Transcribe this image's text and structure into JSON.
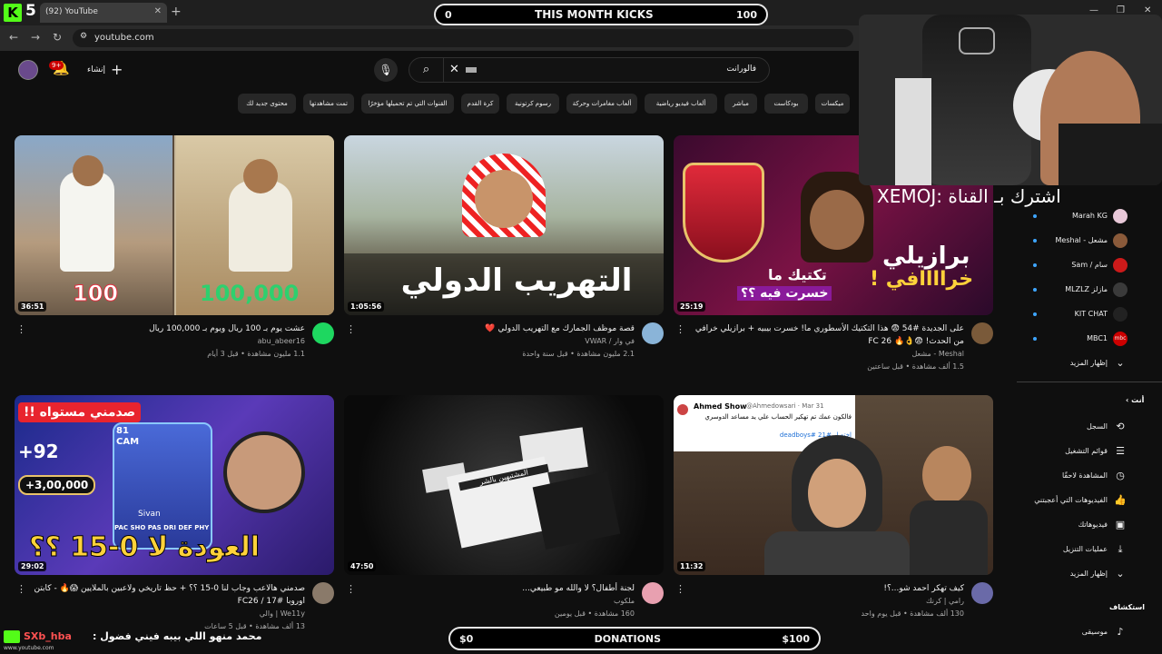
{
  "browser": {
    "stream_number": "5",
    "tab_title": "(92) YouTube",
    "url": "youtube.com"
  },
  "overlay": {
    "kicks": {
      "left": "0",
      "label": "THIS MONTH KICKS",
      "right": "100"
    },
    "donations": {
      "left": "$0",
      "label": "DONATIONS",
      "right": "$100"
    },
    "chat_overlay": "XEMOJ: اشترك بـ القناة",
    "chat_message": {
      "user": "SXb_hba",
      "text": ": محمد منهو اللي بيبه فيني فضول",
      "watermark": "www.youtube.com"
    }
  },
  "youtube": {
    "notification_count": "9+",
    "create_label": "إنشاء",
    "search_query": "فالورانت",
    "chips": [
      "ميكسات",
      "بودكاست",
      "مباشر",
      "ألعاب فيديو رياضية",
      "ألعاب مغامرات وحركة",
      "رسوم كرتونية",
      "كرة القدم",
      "القنوات التي تم تحميلها مؤخرًا",
      "تمت مشاهدتها",
      "محتوى جديد لك"
    ],
    "videos": [
      {
        "title": "عشت يوم بـ 100 ريال ويوم بـ 100,000 ريال",
        "channel": "abu_abeer16",
        "meta": "1.1 مليون مشاهدة • قبل 3 أيام",
        "duration": "36:51",
        "thumb_left": "100",
        "thumb_right": "100,000"
      },
      {
        "title": "قصة موظف الجمارك مع التهريب الدولي ❤️",
        "channel": "في وار / VWAR",
        "meta": "2.1 مليون مشاهدة • قبل سنة واحدة",
        "duration": "1:05:56",
        "thumb_text": "التهريب الدولي"
      },
      {
        "title": "على الجديدة #54 😨 هذا التكتيك الأسطوري ما! خسرت بيبيه + برازيلي خرافي من الحدث! 😨👌🔥 FC 26",
        "channel": "Meshal - مشعل",
        "meta": "1.5 ألف مشاهدة • قبل ساعتين",
        "duration": "25:19",
        "thumb_text1": "برازيلي",
        "thumb_text2": "خراااافي !",
        "thumb_text3": "تكتيك ما",
        "thumb_text4": "خسرت فيه ؟؟"
      },
      {
        "title": "صدمني هالاعب وجاب لنا 0-15 ؟؟ + حظ تاريخي ولاعبين بالملايين 😱🔥 - كابتن اوروبا #17 / FC26",
        "channel": "We11y | والي",
        "meta": "13 ألف مشاهدة • قبل 5 ساعات",
        "duration": "29:02",
        "thumb_top": "صدمني مستواه !!",
        "thumb_bottom": "العودة لا 0-15 ؟؟",
        "thumb_rating": "+92",
        "thumb_coins": "+3,00,000",
        "thumb_pos": "81 CAM",
        "thumb_name": "Sivan",
        "thumb_stats": "PAC SHO PAS DRI DEF PHY"
      },
      {
        "title": "لجنة أطفال؟ لا والله مو طبيعي...",
        "channel": "ملكوب",
        "meta": "160 مشاهدة • قبل يومين",
        "duration": "47:50",
        "thumb_paper": "المشتبهين بالشر"
      },
      {
        "title": "كيف تهكر احمد شو...؟!",
        "channel": "رامي | كرنك",
        "meta": "130 ألف مشاهدة • قبل يوم واحد",
        "duration": "11:32",
        "tweet_user": "Ahmed Show",
        "tweet_handle": "@Ahmedowsari · Mar 31",
        "tweet_text": "فالكون عمك تم تهكير الحساب علي يد مساعد الدوسري",
        "tweet_tag": "اختصار #21 #deadboys"
      }
    ],
    "subscriptions": [
      {
        "name": "Marah KG"
      },
      {
        "name": "مشعل - Meshal"
      },
      {
        "name": "سام / Sam"
      },
      {
        "name": "مازلز MLZLZ"
      },
      {
        "name": "KIT CHAT"
      },
      {
        "name": "MBC1"
      }
    ],
    "show_more_1": "إظهار المزيد",
    "you_section": "أنت",
    "you_items": [
      "السجل",
      "قوائم التشغيل",
      "المشاهدة لاحقًا",
      "الفيديوهات التي أعجبتني",
      "فيديوهاتك",
      "عمليات التنزيل"
    ],
    "show_more_2": "إظهار المزيد",
    "explore_section": "استكشاف",
    "explore_items": [
      "موسيقى"
    ]
  }
}
